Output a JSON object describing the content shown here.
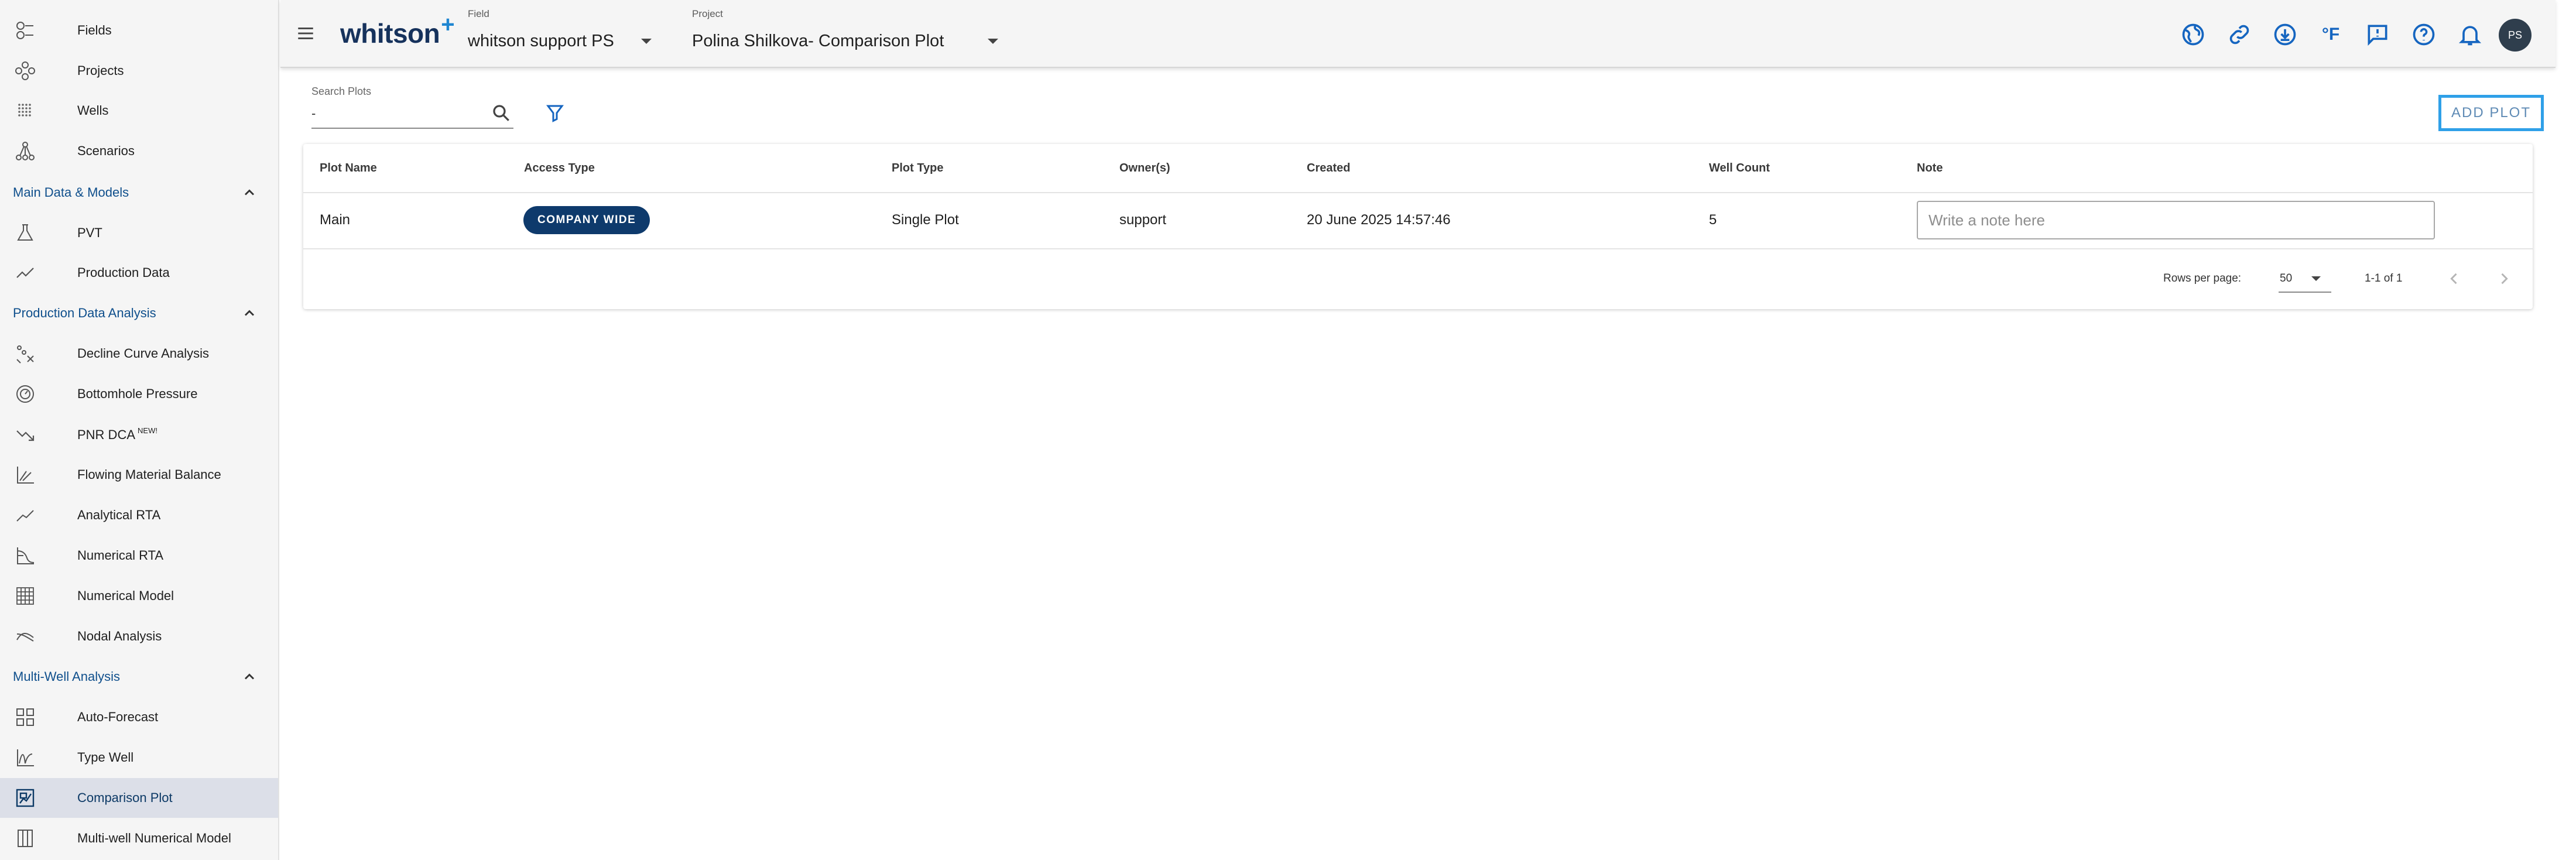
{
  "sidebar": {
    "top_items": [
      {
        "label": "Fields",
        "icon": "fields-icon"
      },
      {
        "label": "Projects",
        "icon": "projects-icon"
      },
      {
        "label": "Wells",
        "icon": "wells-icon"
      },
      {
        "label": "Scenarios",
        "icon": "scenarios-icon"
      }
    ],
    "sections": [
      {
        "title": "Main Data & Models",
        "items": [
          {
            "label": "PVT",
            "icon": "flask-icon"
          },
          {
            "label": "Production Data",
            "icon": "trend-line-icon"
          }
        ]
      },
      {
        "title": "Production Data Analysis",
        "items": [
          {
            "label": "Decline Curve Analysis",
            "icon": "decline-curve-icon"
          },
          {
            "label": "Bottomhole Pressure",
            "icon": "pressure-gauge-icon"
          },
          {
            "label": "PNR DCA",
            "badge": "NEW!",
            "icon": "down-trend-icon"
          },
          {
            "label": "Flowing Material Balance",
            "icon": "chart-lines-icon"
          },
          {
            "label": "Analytical RTA",
            "icon": "analytical-rta-icon"
          },
          {
            "label": "Numerical RTA",
            "icon": "numerical-rta-icon"
          },
          {
            "label": "Numerical Model",
            "icon": "grid-model-icon"
          },
          {
            "label": "Nodal Analysis",
            "icon": "nodal-curves-icon"
          }
        ]
      },
      {
        "title": "Multi-Well Analysis",
        "items": [
          {
            "label": "Auto-Forecast",
            "icon": "tiles-icon"
          },
          {
            "label": "Type Well",
            "icon": "type-well-icon"
          },
          {
            "label": "Comparison Plot",
            "icon": "comparison-plot-icon",
            "active": true
          },
          {
            "label": "Multi-well Numerical Model",
            "icon": "columns-icon"
          }
        ]
      }
    ]
  },
  "topbar": {
    "logo": "whitson",
    "logo_plus": "+",
    "field_label": "Field",
    "field_value": "whitson support PS",
    "project_label": "Project",
    "project_value": "Polina Shilkova- Comparison Plot",
    "avatar_initials": "PS",
    "icons": [
      "globe-icon",
      "link-icon",
      "download-icon",
      "fahrenheit-icon",
      "feedback-icon",
      "help-icon",
      "bell-icon"
    ],
    "units_text": "°F"
  },
  "search": {
    "label": "Search Plots",
    "value": "-"
  },
  "add_plot_label": "ADD PLOT",
  "table": {
    "columns": [
      "Plot Name",
      "Access Type",
      "Plot Type",
      "Owner(s)",
      "Created",
      "Well Count",
      "Note"
    ],
    "rows": [
      {
        "plot_name": "Main",
        "access_type": "COMPANY WIDE",
        "plot_type": "Single Plot",
        "owners": "support",
        "created": "20 June 2025 14:57:46",
        "well_count": "5",
        "note_placeholder": "Write a note here"
      }
    ]
  },
  "pagination": {
    "rows_per_page_label": "Rows per page:",
    "rows_per_page": "50",
    "range": "1-1 of 1"
  },
  "colors": {
    "accent": "#0f4f8c",
    "chip": "#0e3a6c",
    "icon_blue": "#1565c0",
    "add_border": "#2fa0e8"
  }
}
